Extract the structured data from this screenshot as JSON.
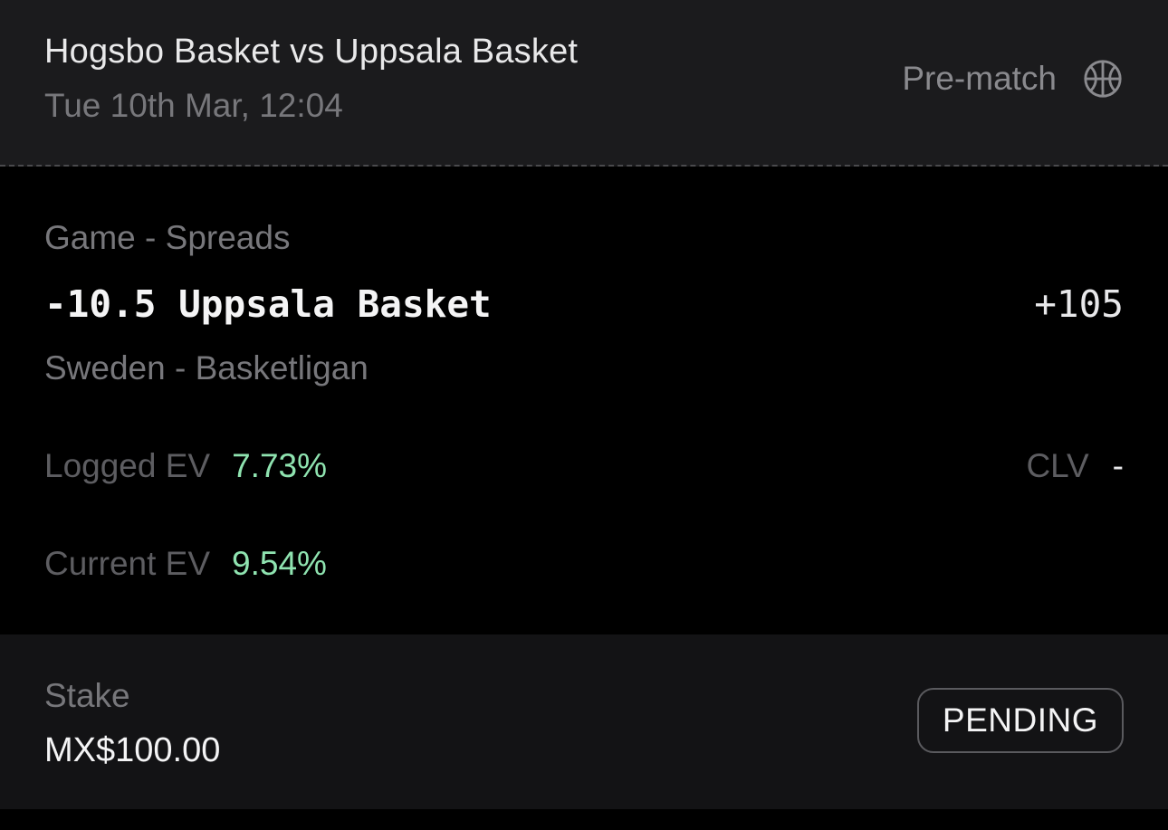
{
  "header": {
    "title": "Hogsbo Basket vs Uppsala Basket",
    "datetime": "Tue 10th Mar, 12:04",
    "status": "Pre-match",
    "sport_icon": "basketball-icon"
  },
  "bet": {
    "market": "Game - Spreads",
    "selection": "-10.5 Uppsala Basket",
    "odds": "+105",
    "league": "Sweden - Basketligan"
  },
  "metrics": {
    "logged_ev_label": "Logged EV",
    "logged_ev_value": "7.73%",
    "current_ev_label": "Current EV",
    "current_ev_value": "9.54%",
    "clv_label": "CLV",
    "clv_value": "-"
  },
  "footer": {
    "stake_label": "Stake",
    "stake_amount": "MX$100.00",
    "badge": "PENDING"
  },
  "colors": {
    "header_bg": "#1b1b1d",
    "main_bg": "#000000",
    "footer_bg": "#131315",
    "positive_ev": "#8fe3b0",
    "muted_text": "#77777b"
  }
}
